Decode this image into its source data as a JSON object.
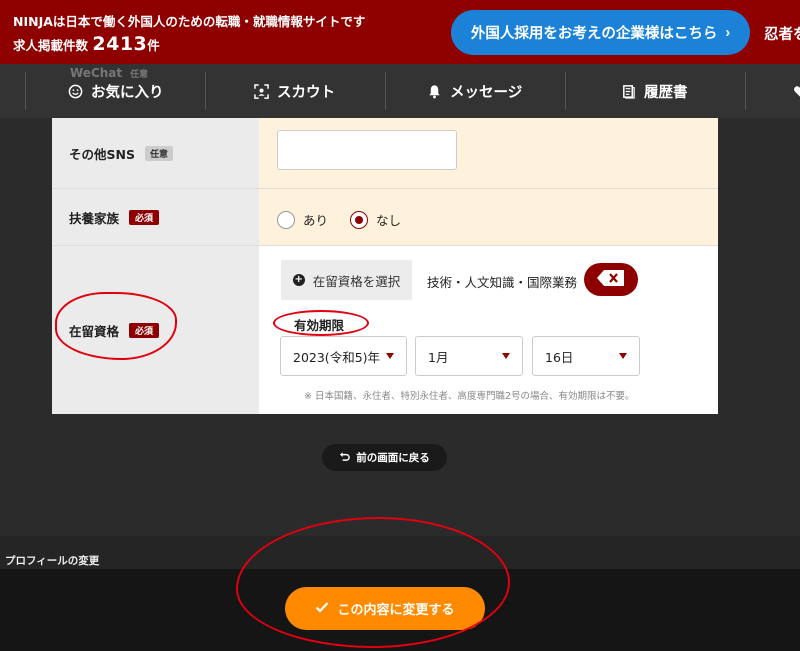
{
  "banner": {
    "tagline": "NINJAは日本で働く外国人のための転職・就職情報サイトです",
    "count_label": "求人掲載件数",
    "count_value": "2413",
    "count_unit": "件",
    "corp_button": "外国人採用をお考えの企業様はこちら",
    "ninja_link": "忍者を"
  },
  "nav": {
    "favorites": "お気に入り",
    "scout": "スカウト",
    "messages": "メッセージ",
    "resume": "履歴書"
  },
  "ghost_row": {
    "label": "WeChat",
    "tag": "任意"
  },
  "form": {
    "other_sns": {
      "label": "その他SNS",
      "tag": "任意",
      "value": ""
    },
    "dependents": {
      "label": "扶養家族",
      "tag": "必須",
      "option_yes": "あり",
      "option_no": "なし",
      "selected": "なし"
    },
    "residence_status": {
      "label": "在留資格",
      "tag": "必須",
      "select_button": "在留資格を選択",
      "selected_value": "技術・人文知識・国際業務",
      "expiry_label": "有効期限",
      "year": "2023(令和5)年",
      "month": "1月",
      "day": "16日",
      "note": "※ 日本国籍、永住者、特別永住者、高度専門職2号の場合、有効期限は不要。"
    }
  },
  "back_button": "前の画面に戻る",
  "profile_change": "プロフィールの変更",
  "submit_button": "この内容に変更する",
  "colors": {
    "brand_red": "#8e0000",
    "accent_blue": "#1b82d7",
    "submit_orange": "#ff8a00",
    "annotation_red": "#e00010"
  }
}
